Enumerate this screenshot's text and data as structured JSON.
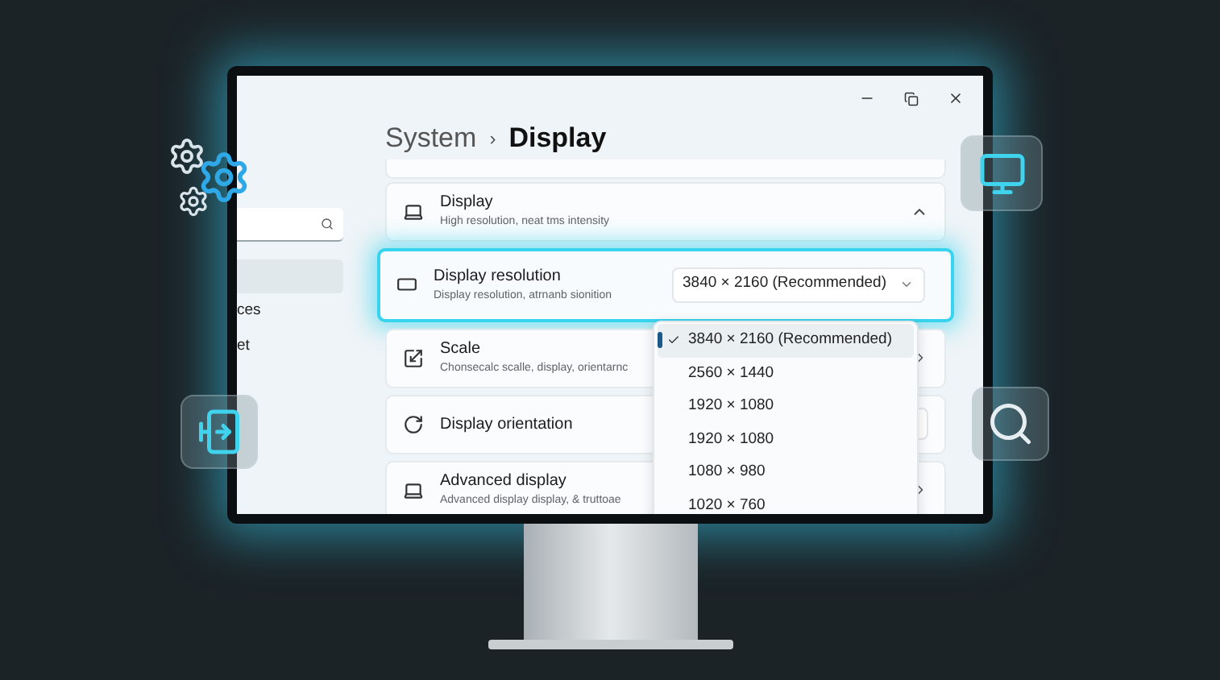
{
  "breadcrumb": {
    "parent": "System",
    "separator": "›",
    "current": "Display"
  },
  "sidebar": {
    "items": [
      {
        "selected": true
      },
      {
        "label": "ces",
        "selected": false
      },
      {
        "label": "et",
        "selected": false
      }
    ]
  },
  "settings": [
    {
      "kind": "expandable",
      "title": "Display",
      "subtitle": "High resolution, neat tms intensity",
      "expanded": true,
      "highlighted": false
    },
    {
      "kind": "dropdown",
      "title": "Display resolution",
      "subtitle": "Display resolution, atrnanb sionition",
      "value": "3840 × 2160 (Recommended)",
      "highlighted": true
    },
    {
      "kind": "link",
      "title": "Scale",
      "subtitle": "Chonsecalc scalle, display, orientarnc",
      "highlighted": false
    },
    {
      "kind": "field",
      "title": "Display orientation",
      "highlighted": false
    },
    {
      "kind": "link",
      "title": "Advanced display",
      "subtitle": "Advanced display display, & truttoae",
      "highlighted": false
    }
  ],
  "dropdown": {
    "options": [
      {
        "label": "3840 × 2160 (Recommended)",
        "selected": true
      },
      {
        "label": "2560 × 1440",
        "selected": false
      },
      {
        "label": "1920 × 1080",
        "selected": false
      },
      {
        "label": "1920 × 1080",
        "selected": false
      },
      {
        "label": "1080 × 980",
        "selected": false
      },
      {
        "label": "1020 × 760",
        "selected": false
      }
    ]
  }
}
